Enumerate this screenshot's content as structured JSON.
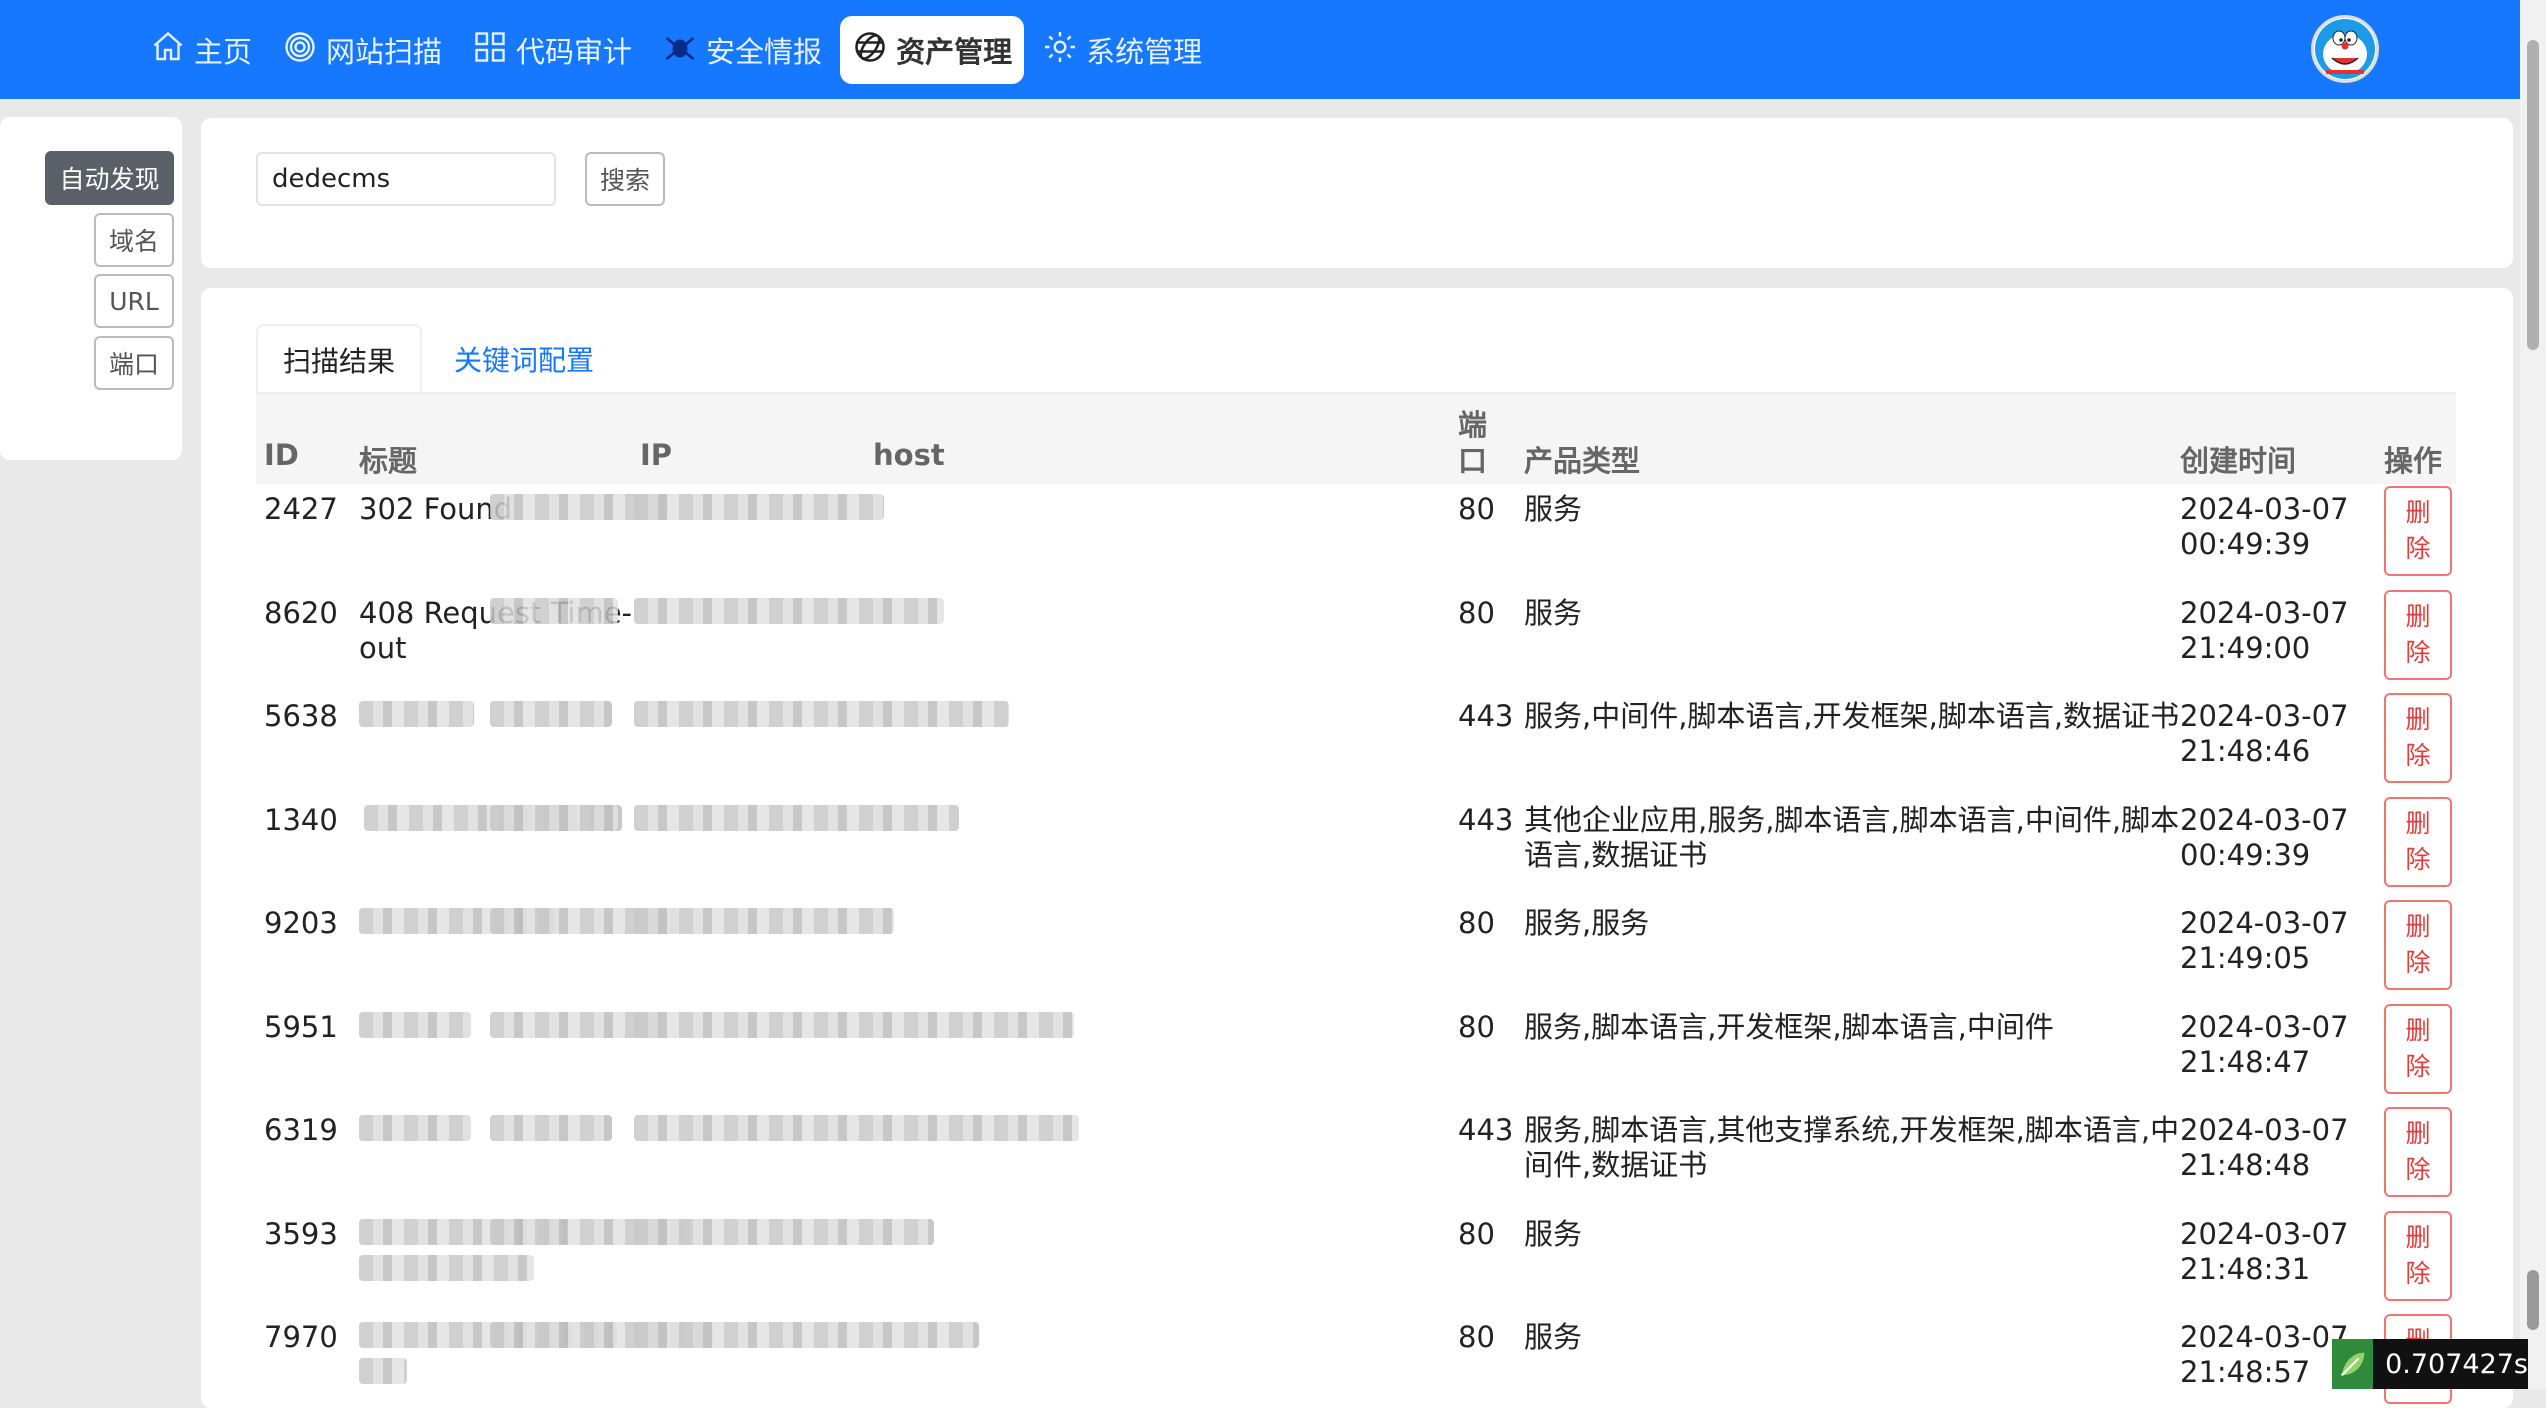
{
  "nav": {
    "items": [
      {
        "label": "主页",
        "icon": "home-icon"
      },
      {
        "label": "网站扫描",
        "icon": "spiral-scan-icon"
      },
      {
        "label": "代码审计",
        "icon": "grid-code-icon"
      },
      {
        "label": "安全情报",
        "icon": "bug-icon"
      },
      {
        "label": "资产管理",
        "icon": "globe-icon",
        "active": true
      },
      {
        "label": "系统管理",
        "icon": "gear-icon"
      }
    ]
  },
  "sidebar": {
    "items": [
      "自动发现",
      "域名",
      "URL",
      "端口"
    ],
    "active": "自动发现"
  },
  "search": {
    "value": "dedecms",
    "button_label": "搜索"
  },
  "tabs": {
    "active": "扫描结果",
    "other": "关键词配置"
  },
  "table": {
    "headers": {
      "id": "ID",
      "title": "标题",
      "ip": "IP",
      "host": "host",
      "port_line1": "端",
      "port_line2": "口",
      "product": "产品类型",
      "created": "创建时间",
      "action": "操作"
    },
    "delete_line1": "删",
    "delete_line2": "除",
    "rows": [
      {
        "id": "2427",
        "title": "302 Found",
        "title2": "",
        "port": "80",
        "product": "服务",
        "product2": "",
        "date": "2024-03-07",
        "time": "00:49:39"
      },
      {
        "id": "8620",
        "title": "408 Request Time-",
        "title2": "out",
        "port": "80",
        "product": "服务",
        "product2": "",
        "date": "2024-03-07",
        "time": "21:49:00"
      },
      {
        "id": "5638",
        "title": "",
        "title2": "",
        "port": "443",
        "product": "服务,中间件,脚本语言,开发框架,脚本语言,数据证书",
        "product2": "",
        "date": "2024-03-07",
        "time": "21:48:46"
      },
      {
        "id": "1340",
        "title": "",
        "title2": "",
        "port": "443",
        "product": "其他企业应用,服务,脚本语言,脚本语言,中间件,脚本",
        "product2": "语言,数据证书",
        "date": "2024-03-07",
        "time": "00:49:39"
      },
      {
        "id": "9203",
        "title": "",
        "title2": "",
        "port": "80",
        "product": "服务,服务",
        "product2": "",
        "date": "2024-03-07",
        "time": "21:49:05"
      },
      {
        "id": "5951",
        "title": "",
        "title2": "",
        "port": "80",
        "product": "服务,脚本语言,开发框架,脚本语言,中间件",
        "product2": "",
        "date": "2024-03-07",
        "time": "21:48:47"
      },
      {
        "id": "6319",
        "title": "",
        "title2": "",
        "port": "443",
        "product": "服务,脚本语言,其他支撑系统,开发框架,脚本语言,中",
        "product2": "间件,数据证书",
        "date": "2024-03-07",
        "time": "21:48:48"
      },
      {
        "id": "3593",
        "title": "",
        "title2": "",
        "port": "80",
        "product": "服务",
        "product2": "",
        "date": "2024-03-07",
        "time": "21:48:31"
      },
      {
        "id": "7970",
        "title": "",
        "title2": "",
        "port": "80",
        "product": "服务",
        "product2": "",
        "date": "2024-03-07",
        "time": "21:48:57"
      }
    ]
  },
  "timer": {
    "value": "0.707427s"
  }
}
